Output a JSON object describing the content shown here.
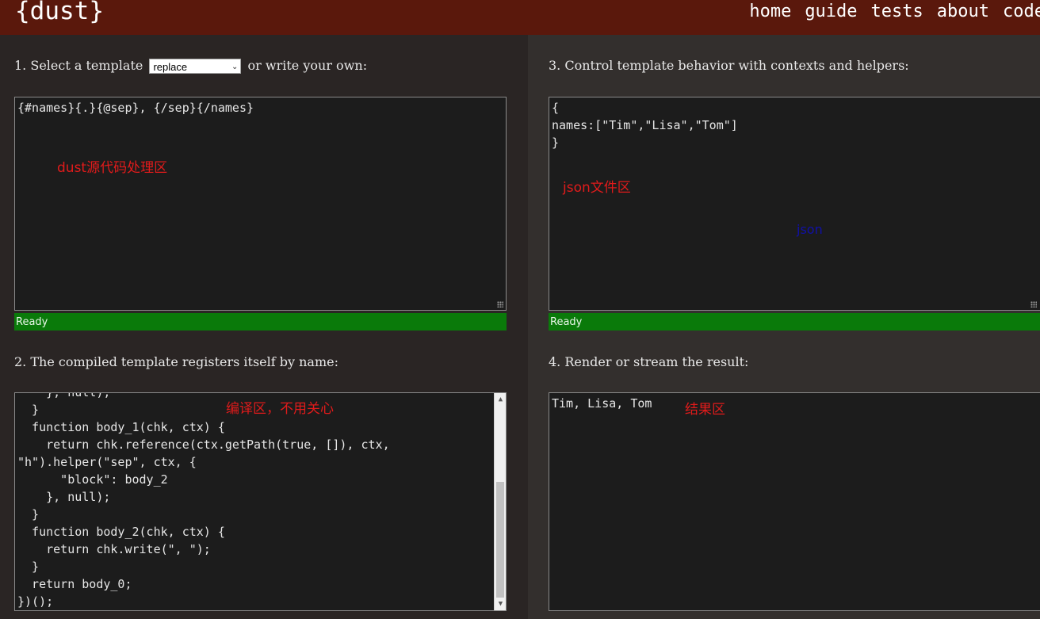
{
  "header": {
    "logo": "{dust}",
    "nav": [
      "home",
      "guide",
      "tests",
      "about",
      "code"
    ]
  },
  "step1": {
    "label_before": "1. Select a template",
    "select_value": "replace",
    "label_after": "or write your own:"
  },
  "step2": {
    "label": "2. The compiled template registers itself by name:"
  },
  "step3": {
    "label": "3. Control template behavior with contexts and helpers:"
  },
  "step4": {
    "label": "4. Render or stream the result:"
  },
  "editors": {
    "template_source": "{#names}{.}{@sep}, {/sep}{/names}",
    "json_context": "{\nnames:[\"Tim\",\"Lisa\",\"Tom\"]\n}",
    "compiled_output": "    }, null);\n  }\n  function body_1(chk, ctx) {\n    return chk.reference(ctx.getPath(true, []), ctx,\n\"h\").helper(\"sep\", ctx, {\n      \"block\": body_2\n    }, null);\n  }\n  function body_2(chk, ctx) {\n    return chk.write(\", \");\n  }\n  return body_0;\n})();",
    "result": "Tim, Lisa, Tom",
    "compiled_scroll_fraction": 1.0
  },
  "status": {
    "template": "Ready",
    "json": "Ready"
  },
  "annotations": {
    "template": "dust源代码处理区",
    "json": "json文件区",
    "json_blue": "json",
    "compiled": "编译区，不用关心",
    "result": "结果区"
  },
  "colors": {
    "header_bg": "#5a180c",
    "status_bg": "#0a7a0a",
    "annotation": "#e11b1b",
    "annotation_blue": "#1010a8"
  }
}
